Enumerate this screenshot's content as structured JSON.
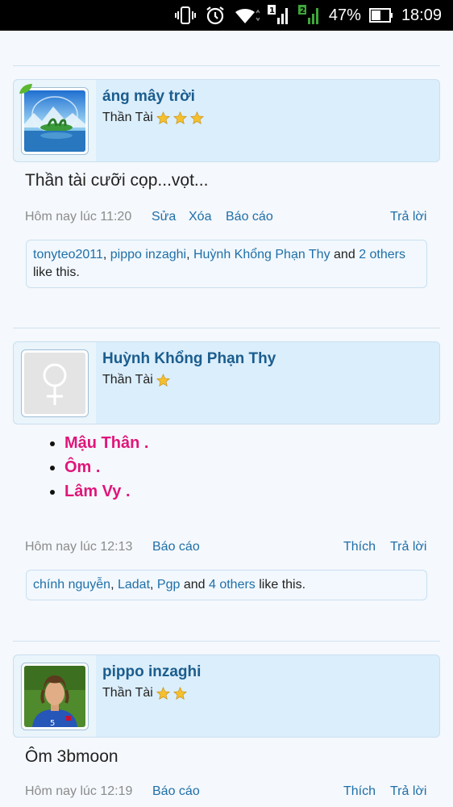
{
  "statusbar": {
    "battery": "47%",
    "time": "18:09",
    "sim1": "1",
    "sim2": "2"
  },
  "posts": [
    {
      "username": "áng mây trời",
      "title": "Thần Tài",
      "message": "Thần tài cưỡi cọp...vọt...",
      "time": "Hôm nay lúc 11:20",
      "actions": {
        "edit": "Sửa",
        "delete": "Xóa",
        "report": "Báo cáo",
        "reply": "Trả lời"
      },
      "likes": {
        "names": [
          "tonyteo2011",
          "pippo inzaghi",
          "Huỳnh Khổng Phạn Thy"
        ],
        "and": "and",
        "others_link": "2 others",
        "tail": "like this."
      }
    },
    {
      "username": "Huỳnh Khổng Phạn Thy",
      "title": "Thần Tài",
      "bullets": [
        "Mậu Thân .",
        "Ôm .",
        "Lâm Vy ."
      ],
      "time": "Hôm nay lúc 12:13",
      "actions": {
        "report": "Báo cáo",
        "like": "Thích",
        "reply": "Trả lời"
      },
      "likes": {
        "names": [
          "chính nguyễn",
          "Ladat",
          "Pgp"
        ],
        "and": "and",
        "others_link": "4 others",
        "tail": "like this."
      }
    },
    {
      "username": "pippo inzaghi",
      "title": "Thần Tài",
      "message": "Ôm 3bmoon",
      "time": "Hôm nay lúc 12:19",
      "actions": {
        "report": "Báo cáo",
        "like": "Thích",
        "reply": "Trả lời"
      }
    }
  ]
}
